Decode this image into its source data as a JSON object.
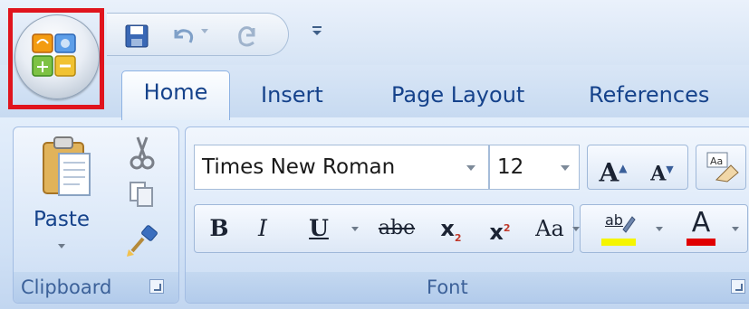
{
  "quick_access": {
    "save_icon": "save-icon",
    "undo_icon": "undo-icon",
    "redo_icon": "redo-icon",
    "customize_icon": "customize-qat-icon"
  },
  "office_button": {
    "icon": "office-logo-icon",
    "highlight_color": "#e0141d"
  },
  "tabs": [
    {
      "label": "Home",
      "active": true
    },
    {
      "label": "Insert",
      "active": false
    },
    {
      "label": "Page Layout",
      "active": false
    },
    {
      "label": "References",
      "active": false
    }
  ],
  "clipboard_group": {
    "label": "Clipboard",
    "paste_label": "Paste",
    "cut_icon": "scissors-icon",
    "copy_icon": "copy-icon",
    "format_painter_icon": "format-painter-icon"
  },
  "font_group": {
    "label": "Font",
    "font_name": "Times New Roman",
    "font_size": "12",
    "grow_font": "A",
    "shrink_font": "A",
    "clear_format_icon": "clear-formatting-icon",
    "bold": "B",
    "italic": "I",
    "underline": "U",
    "strikethrough": "abe",
    "subscript": "x",
    "superscript": "x",
    "subscript_mark": "2",
    "superscript_mark": "2",
    "change_case": "Aa",
    "highlight_text": "ab",
    "highlight_color": "#f5f500",
    "font_color_letter": "A",
    "font_color": "#e00000"
  },
  "colors": {
    "tab_text": "#15428b",
    "group_label": "#3c6199"
  }
}
